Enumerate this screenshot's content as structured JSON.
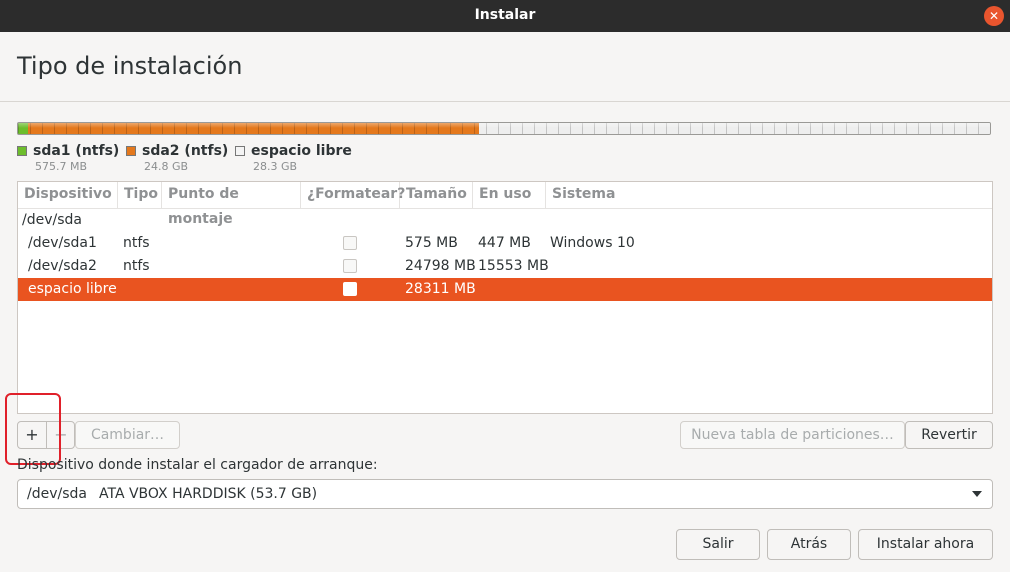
{
  "window": {
    "title": "Instalar"
  },
  "page": {
    "title": "Tipo de instalación"
  },
  "colors": {
    "accent": "#e95420",
    "sda1": "#6dbd2c",
    "sda2": "#e4781c",
    "free": "#eeeeee",
    "titlebar": "#2c2c2c"
  },
  "partition_bar": {
    "segments": [
      {
        "name": "sda1 (ntfs)",
        "size": "575.7 MB",
        "fraction": 0.011
      },
      {
        "name": "sda2 (ntfs)",
        "size": "24.8 GB",
        "fraction": 0.463
      },
      {
        "name": "espacio libre",
        "size": "28.3 GB",
        "fraction": 0.526
      }
    ]
  },
  "table": {
    "columns": [
      "Dispositivo",
      "Tipo",
      "Punto de montaje",
      "¿Formatear?",
      "Tamaño",
      "En uso",
      "Sistema"
    ],
    "rows": [
      {
        "device": "/dev/sda",
        "type": "",
        "mount": "",
        "format": null,
        "size": "",
        "used": "",
        "system": ""
      },
      {
        "device": "/dev/sda1",
        "type": "ntfs",
        "mount": "",
        "format": false,
        "size": "575 MB",
        "used": "447 MB",
        "system": "Windows 10"
      },
      {
        "device": "/dev/sda2",
        "type": "ntfs",
        "mount": "",
        "format": false,
        "size": "24798 MB",
        "used": "15553 MB",
        "system": ""
      },
      {
        "device": "espacio libre",
        "type": "",
        "mount": "",
        "format": false,
        "size": "28311 MB",
        "used": "",
        "system": "",
        "selected": true
      }
    ]
  },
  "toolbar": {
    "add_label": "+",
    "remove_label": "−",
    "change_label": "Cambiar…",
    "new_table_label": "Nueva tabla de particiones…",
    "revert_label": "Revertir"
  },
  "bootloader": {
    "label": "Dispositivo donde instalar el cargador de arranque:",
    "selected_device": "/dev/sda",
    "selected_desc": "ATA VBOX HARDDISK (53.7 GB)"
  },
  "footer": {
    "quit_label": "Salir",
    "back_label": "Atrás",
    "install_label": "Instalar ahora"
  }
}
